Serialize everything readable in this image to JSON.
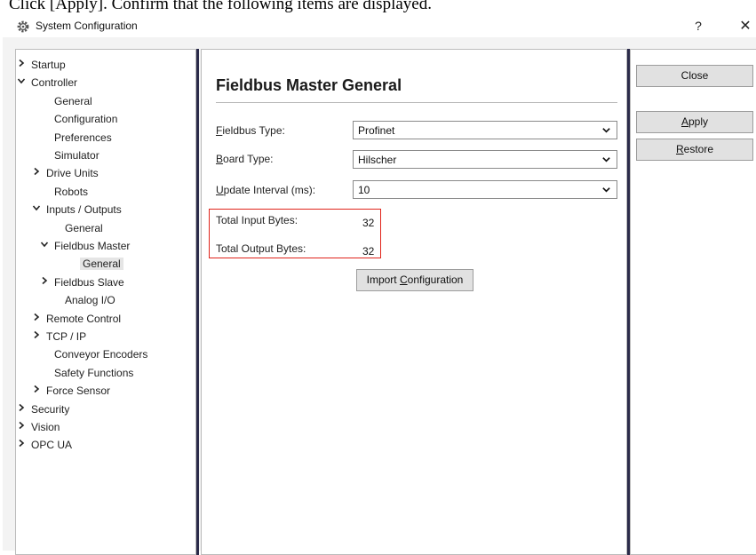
{
  "document": {
    "instruction": "Click [Apply]. Confirm that the following items are displayed."
  },
  "window": {
    "title": "System Configuration",
    "help_label": "?",
    "close_label": "✕"
  },
  "nav": {
    "items": [
      {
        "label": "Startup",
        "expander": "closed"
      },
      {
        "label": "Controller",
        "expander": "open"
      },
      {
        "label": "General"
      },
      {
        "label": "Configuration"
      },
      {
        "label": "Preferences"
      },
      {
        "label": "Simulator"
      },
      {
        "label": "Drive Units",
        "expander": "closed"
      },
      {
        "label": "Robots"
      },
      {
        "label": "Inputs / Outputs",
        "expander": "open"
      },
      {
        "label": "General"
      },
      {
        "label": "Fieldbus Master",
        "expander": "open"
      },
      {
        "label": "General",
        "selected": true
      },
      {
        "label": "Fieldbus Slave",
        "expander": "closed"
      },
      {
        "label": "Analog I/O"
      },
      {
        "label": "Remote Control",
        "expander": "closed"
      },
      {
        "label": "TCP / IP",
        "expander": "closed"
      },
      {
        "label": "Conveyor Encoders"
      },
      {
        "label": "Safety Functions"
      },
      {
        "label": "Force Sensor",
        "expander": "closed"
      },
      {
        "label": "Security",
        "expander": "closed"
      },
      {
        "label": "Vision",
        "expander": "closed"
      },
      {
        "label": "OPC UA",
        "expander": "closed"
      }
    ]
  },
  "main": {
    "title": "Fieldbus Master General",
    "fieldbus_type": {
      "label_first": "F",
      "label_rest": "ieldbus Type:",
      "value": "Profinet"
    },
    "board_type": {
      "label_first": "B",
      "label_rest": "oard Type:",
      "value": "Hilscher"
    },
    "update_interval": {
      "label_first": "U",
      "label_rest": "pdate Interval (ms):",
      "value": "10"
    },
    "total_input_bytes": {
      "label": "Total Input Bytes:",
      "value": "32"
    },
    "total_output_bytes": {
      "label": "Total Output Bytes:",
      "value": "32"
    },
    "import_button": {
      "label_pre": "Import ",
      "label_first": "C",
      "label_rest": "onfiguration"
    }
  },
  "buttons": {
    "close": {
      "label": "Close"
    },
    "apply": {
      "label_first": "A",
      "label_rest": "pply"
    },
    "restore": {
      "label_first": "R",
      "label_rest": "estore"
    }
  },
  "colors": {
    "highlight_border": "#e0241b",
    "divider": "#2b2b4a"
  }
}
